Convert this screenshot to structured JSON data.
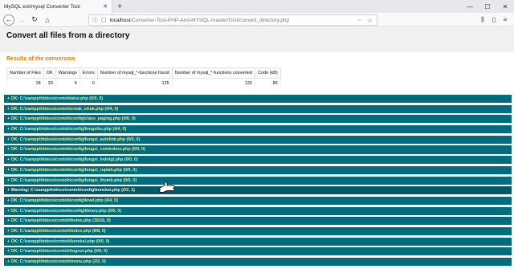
{
  "browser": {
    "tab_title": "MySQL ext/mysql Converter Tool",
    "tab_close": "✕",
    "new_tab": "+",
    "url_host": "localhost",
    "url_rest": "/Converter-Tool-PHP-And-MYSQL-master/GUI/convert_directory.php",
    "more": "···",
    "window_controls": [
      "—",
      "☐",
      "✕"
    ]
  },
  "page": {
    "title": "Convert all files from a directory",
    "section_title": "Results of the conversion"
  },
  "stats": {
    "headers": [
      "Number of Files",
      "OK",
      "Warnings",
      "Errors",
      "Number of mysql_*-functions found",
      "Number of mysql_*-functions converted",
      "Code (kB)"
    ],
    "values": [
      "34",
      "30",
      "4",
      "0",
      "125",
      "125",
      "86"
    ]
  },
  "results": [
    {
      "text": "+ OK: C:\\xampp\\htdocs\\contoh\\aksi.php (0/0, 0)",
      "status": "ok"
    },
    {
      "text": "+ OK: C:\\xampp\\htdocs\\contoh\\cetak_struk.php (4/4, 0)",
      "status": "ok"
    },
    {
      "text": "+ OK: C:\\xampp\\htdocs\\contoh\\config\\class_paging.php (0/0, 0)",
      "status": "ok"
    },
    {
      "text": "+ OK: C:\\xampp\\htdocs\\contoh\\config\\fungsiku.php (4/4, 0)",
      "status": "ok"
    },
    {
      "text": "+ OK: C:\\xampp\\htdocs\\contoh\\config\\fungsi_autolink.php (0/0, 0)",
      "status": "ok"
    },
    {
      "text": "+ OK: C:\\xampp\\htdocs\\contoh\\config\\fungsi_combobox.php (0/0, 0)",
      "status": "ok"
    },
    {
      "text": "+ OK: C:\\xampp\\htdocs\\contoh\\config\\fungsi_indotgl.php (0/0, 0)",
      "status": "ok"
    },
    {
      "text": "+ OK: C:\\xampp\\htdocs\\contoh\\config\\fungsi_rupiah.php (0/0, 0)",
      "status": "ok"
    },
    {
      "text": "+ OK: C:\\xampp\\htdocs\\contoh\\config\\fungsi_thumb.php (0/0, 0)",
      "status": "ok"
    },
    {
      "text": "+ Warning: C:\\xampp\\htdocs\\contoh\\config\\koneksi.php (2/2, 1)",
      "status": "warning"
    },
    {
      "text": "+ OK: C:\\xampp\\htdocs\\contoh\\config\\level.php (4/4, 0)",
      "status": "ok"
    },
    {
      "text": "+ OK: C:\\xampp\\htdocs\\contoh\\config\\library.php (0/0, 0)",
      "status": "ok"
    },
    {
      "text": "+ OK: C:\\xampp\\htdocs\\contoh\\home.php (16/16, 0)",
      "status": "ok"
    },
    {
      "text": "+ OK: C:\\xampp\\htdocs\\contoh\\index.php (8/8, 0)",
      "status": "ok"
    },
    {
      "text": "+ OK: C:\\xampp\\htdocs\\contoh\\koreksi.php (0/0, 0)",
      "status": "ok"
    },
    {
      "text": "+ OK: C:\\xampp\\htdocs\\contoh\\logout.php (0/0, 0)",
      "status": "ok"
    },
    {
      "text": "+ OK: C:\\xampp\\htdocs\\contoh\\menu.php (2/2, 0)",
      "status": "ok"
    }
  ]
}
